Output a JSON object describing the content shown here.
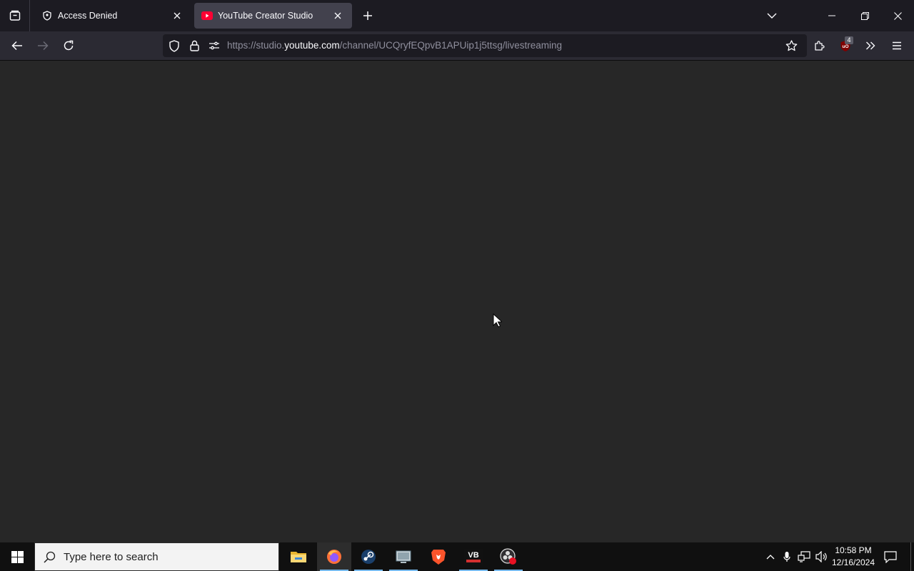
{
  "browser": {
    "tabs": [
      {
        "title": "Access Denied",
        "favicon": "shield-user-icon",
        "active": false
      },
      {
        "title": "YouTube Creator Studio",
        "favicon": "youtube-icon",
        "active": true
      }
    ],
    "url": {
      "prefix": "https://studio.",
      "domain": "youtube.com",
      "suffix": "/channel/UCQryfEQpvB1APUip1j5ttsg/livestreaming"
    },
    "extension_badge": "4"
  },
  "taskbar": {
    "search_placeholder": "Type here to search",
    "apps": [
      "file-explorer-icon",
      "firefox-icon",
      "steam-icon",
      "screen-app-icon",
      "brave-icon",
      "vb-audio-icon",
      "obs-icon"
    ],
    "clock": {
      "time": "10:58 PM",
      "date": "12/16/2024"
    }
  },
  "colors": {
    "accent": "#76b9ed",
    "youtube_red": "#ff0033",
    "page_bg": "#272727"
  }
}
